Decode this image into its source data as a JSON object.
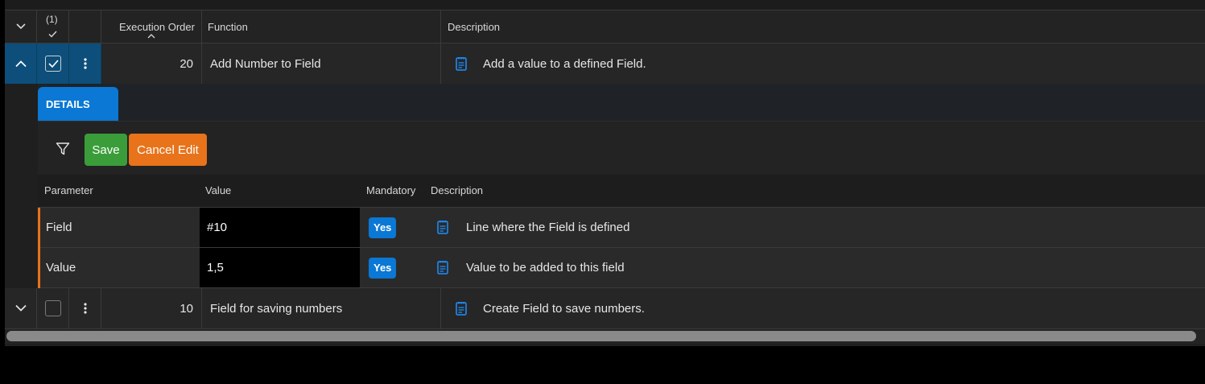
{
  "grid": {
    "header": {
      "selection_count": "(1)",
      "execution_order": "Execution Order",
      "function": "Function",
      "description": "Description"
    },
    "rows": [
      {
        "order": "20",
        "function": "Add Number to Field",
        "description": "Add a value to a defined Field.",
        "selected": true,
        "expanded": true
      },
      {
        "order": "10",
        "function": "Field for saving numbers",
        "description": "Create Field to save numbers.",
        "selected": false,
        "expanded": false
      }
    ]
  },
  "details": {
    "tab_label": "DETAILS",
    "toolbar": {
      "save_label": "Save",
      "cancel_label": "Cancel Edit"
    },
    "columns": {
      "parameter": "Parameter",
      "value": "Value",
      "mandatory": "Mandatory",
      "description": "Description"
    },
    "params": [
      {
        "name": "Field",
        "value": "#10",
        "mandatory": "Yes",
        "description": "Line where the Field is defined"
      },
      {
        "name": "Value",
        "value": "1,5",
        "mandatory": "Yes",
        "description": "Value to be added to this field"
      }
    ]
  },
  "icons": {
    "expand": "chevron-down-icon",
    "collapse": "chevron-up-icon",
    "menu": "kebab-menu-icon",
    "note": "note-icon",
    "filter": "filter-icon",
    "sort": "sort-ascending-icon"
  },
  "colors": {
    "accent_blue": "#0a78d4",
    "selected_row": "#0d4f7a",
    "save_green": "#3a9d3a",
    "cancel_orange": "#e8731a",
    "note_icon": "#1e90ff"
  }
}
